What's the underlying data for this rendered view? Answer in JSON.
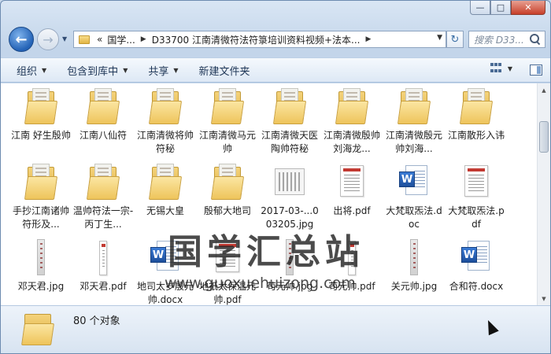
{
  "window": {
    "minimize_glyph": "—",
    "maximize_glyph": "□",
    "close_glyph": "✕"
  },
  "address": {
    "overflow_glyph": "«",
    "segments": [
      "国学...",
      "D33700 江南清微符法符箓培训资料视频+法本..."
    ],
    "refresh_glyph": "↻"
  },
  "search": {
    "placeholder": "搜索 D33..."
  },
  "toolbar": {
    "organize": "组织",
    "include_library": "包含到库中",
    "share": "共享",
    "new_folder": "新建文件夹"
  },
  "files": [
    {
      "name": "江南 好生殷帅",
      "type": "folder"
    },
    {
      "name": "江南八仙符",
      "type": "folder"
    },
    {
      "name": "江南清微将帅符秘",
      "type": "folder"
    },
    {
      "name": "江南清微马元帅",
      "type": "folder"
    },
    {
      "name": "江南清微天医陶帅符秘",
      "type": "folder"
    },
    {
      "name": "江南清微殷帅刘海龙...",
      "type": "folder"
    },
    {
      "name": "江南清微殷元帅刘海...",
      "type": "folder"
    },
    {
      "name": "江南散形入讳",
      "type": "folder"
    },
    {
      "name": "手抄江南诸帅符形及...",
      "type": "folder"
    },
    {
      "name": "温帅符法一宗-丙丁生...",
      "type": "folder"
    },
    {
      "name": "无锡大皇",
      "type": "folder"
    },
    {
      "name": "殷郁大地司",
      "type": "folder"
    },
    {
      "name": "2017-03-...003205.jpg",
      "type": "jpg-wide"
    },
    {
      "name": "出将.pdf",
      "type": "pdf"
    },
    {
      "name": "大梵取炁法.doc",
      "type": "doc"
    },
    {
      "name": "大梵取炁法.pdf",
      "type": "pdf"
    },
    {
      "name": "邓天君.jpg",
      "type": "jpg"
    },
    {
      "name": "邓天君.pdf",
      "type": "pdf-narrow"
    },
    {
      "name": "地司太岁殷元帅.docx",
      "type": "doc"
    },
    {
      "name": "地祇太保温元帅.pdf",
      "type": "pdf"
    },
    {
      "name": "苟元帅.jpg",
      "type": "jpg"
    },
    {
      "name": "苟元帅.pdf",
      "type": "pdf-narrow"
    },
    {
      "name": "关元帅.jpg",
      "type": "jpg"
    },
    {
      "name": "合和符.docx",
      "type": "doc"
    }
  ],
  "watermark": {
    "cn": "国学汇总站",
    "en": "www.guoxuehuizong.com"
  },
  "details": {
    "count": "80 个对象"
  }
}
